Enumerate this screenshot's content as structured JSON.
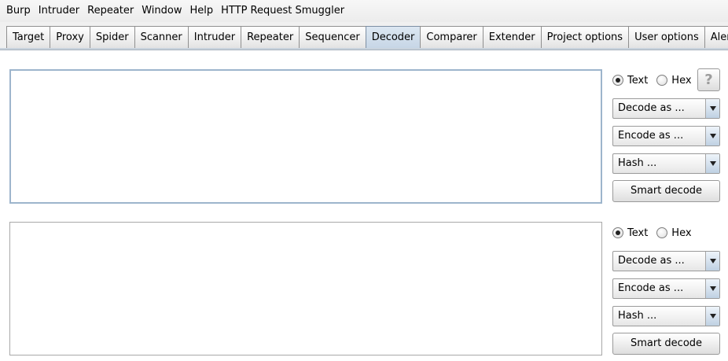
{
  "menu": [
    "Burp",
    "Intruder",
    "Repeater",
    "Window",
    "Help",
    "HTTP Request Smuggler"
  ],
  "tabs": [
    "Target",
    "Proxy",
    "Spider",
    "Scanner",
    "Intruder",
    "Repeater",
    "Sequencer",
    "Decoder",
    "Comparer",
    "Extender",
    "Project options",
    "User options",
    "Alerts"
  ],
  "active_tab": "Decoder",
  "help_label": "?",
  "panels": [
    {
      "editor_text": "",
      "radio_text": "Text",
      "radio_hex": "Hex",
      "selected_mode": "Text",
      "decode_label": "Decode as ...",
      "encode_label": "Encode as ...",
      "hash_label": "Hash ...",
      "smart_label": "Smart decode"
    },
    {
      "editor_text": "",
      "radio_text": "Text",
      "radio_hex": "Hex",
      "selected_mode": "Text",
      "decode_label": "Decode as ...",
      "encode_label": "Encode as ...",
      "hash_label": "Hash ...",
      "smart_label": "Smart decode"
    }
  ]
}
